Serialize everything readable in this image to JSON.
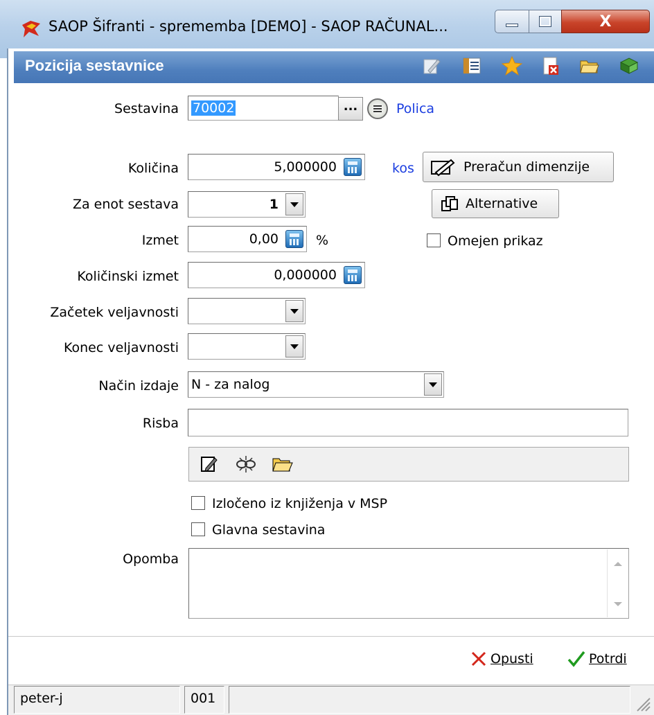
{
  "window": {
    "title": "SAOP Šifranti - sprememba [DEMO] - SAOP RAČUNAL...",
    "minimize_icon": "minimize-icon",
    "maximize_icon": "maximize-icon",
    "close_label": "X"
  },
  "header": {
    "title": "Pozicija sestavnice",
    "icons": [
      "edit-icon",
      "list-icon",
      "star-icon",
      "delete-icon",
      "open-folder-icon",
      "book-icon"
    ]
  },
  "form": {
    "sestavina": {
      "label": "Sestavina",
      "value": "70002",
      "browse_label": "...",
      "link": "Polica"
    },
    "kolicina": {
      "label": "Količina",
      "value": "5,000000",
      "unit": "kos"
    },
    "za_enot_sestava": {
      "label": "Za enot sestava",
      "value": "1"
    },
    "izmet": {
      "label": "Izmet",
      "value": "0,00",
      "unit": "%"
    },
    "kolicinski_izmet": {
      "label": "Količinski izmet",
      "value": "0,000000"
    },
    "zacetek_veljavnosti": {
      "label": "Začetek veljavnosti",
      "value": ""
    },
    "konec_veljavnosti": {
      "label": "Konec veljavnosti",
      "value": ""
    },
    "nacin_izdaje": {
      "label": "Način izdaje",
      "value": "N - za nalog"
    },
    "risba": {
      "label": "Risba",
      "value": ""
    },
    "opomba": {
      "label": "Opomba",
      "value": ""
    }
  },
  "side": {
    "preracun_button": "Preračun dimenzije",
    "alternative_button": "Alternative",
    "omejen_prikaz": "Omejen prikaz"
  },
  "checkboxes": {
    "izloceno": "Izločeno iz knjiženja v MSP",
    "glavna": "Glavna sestavina"
  },
  "footer": {
    "cancel_label": "Opusti",
    "confirm_label": "Potrdi"
  },
  "status": {
    "user": "peter-j",
    "code": "001"
  },
  "colors": {
    "header_blue": "#4f7fbd",
    "link_blue": "#1a3de0",
    "selection": "#3399ff"
  }
}
